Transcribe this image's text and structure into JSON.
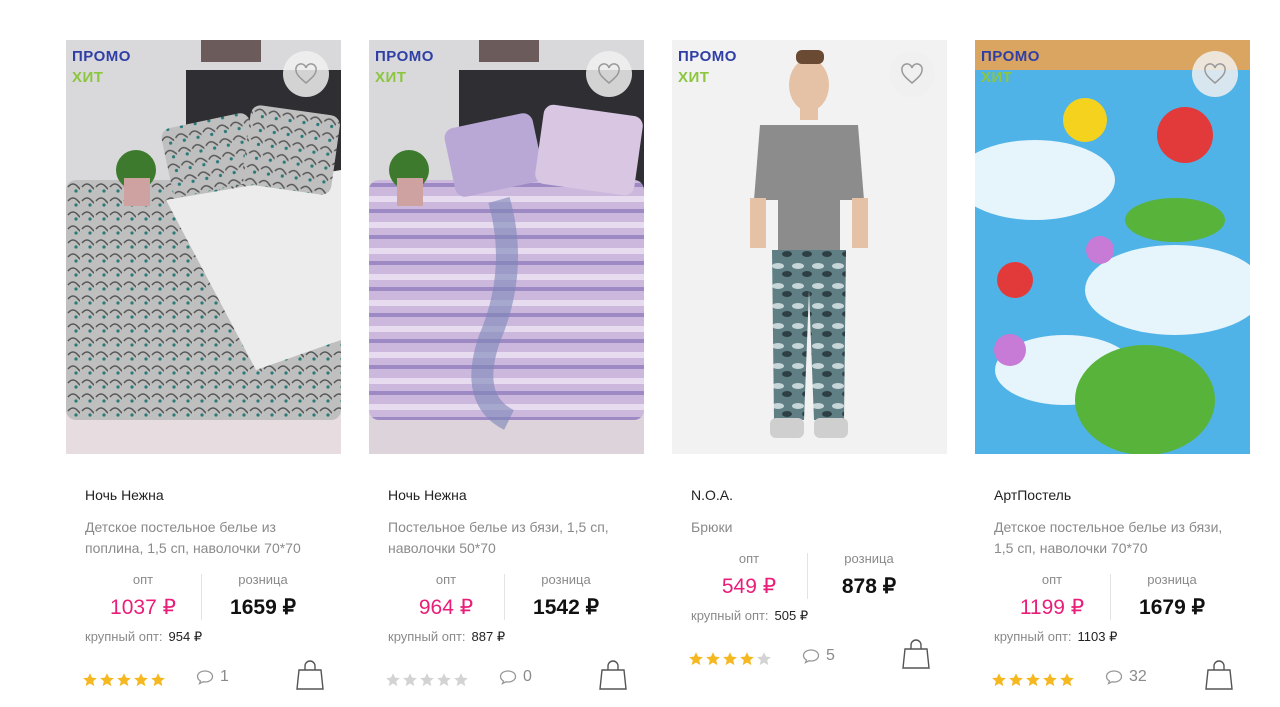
{
  "products": [
    {
      "badge_promo": "ПРОМО",
      "badge_hit": "ХИТ",
      "brand": "Ночь Нежна",
      "description": "Детское постельное белье из поплина, 1,5 сп, наволочки 70*70",
      "opt_label": "опт",
      "retail_label": "розница",
      "opt_price": "1037 ₽",
      "retail_price": "1659 ₽",
      "wholesale_label": "крупный опт:",
      "wholesale_price": "954 ₽",
      "rating": 5,
      "comments": "1"
    },
    {
      "badge_promo": "ПРОМО",
      "badge_hit": "ХИТ",
      "brand": "Ночь Нежна",
      "description": "Постельное белье из бязи, 1,5 сп, наволочки 50*70",
      "opt_label": "опт",
      "retail_label": "розница",
      "opt_price": "964 ₽",
      "retail_price": "1542 ₽",
      "wholesale_label": "крупный опт:",
      "wholesale_price": "887 ₽",
      "rating": 0,
      "comments": "0"
    },
    {
      "badge_promo": "ПРОМО",
      "badge_hit": "ХИТ",
      "brand": "N.O.A.",
      "description": "Брюки",
      "opt_label": "опт",
      "retail_label": "розница",
      "opt_price": "549 ₽",
      "retail_price": "878 ₽",
      "wholesale_label": "крупный опт:",
      "wholesale_price": "505 ₽",
      "rating": 4,
      "comments": "5"
    },
    {
      "badge_promo": "ПРОМО",
      "badge_hit": "ХИТ",
      "brand": "АртПостель",
      "description": "Детское постельное белье из бязи, 1,5 сп, наволочки 70*70",
      "opt_label": "опт",
      "retail_label": "розница",
      "opt_price": "1199 ₽",
      "retail_price": "1679 ₽",
      "wholesale_label": "крупный опт:",
      "wholesale_price": "1103 ₽",
      "rating": 5,
      "comments": "32"
    }
  ],
  "colors": {
    "promo": "#2f3fa6",
    "hit": "#8cc63f",
    "opt_price": "#e91e79",
    "star_on": "#f5b820",
    "star_off": "#d3d3d3"
  },
  "icons": {
    "favorite": "heart-outline-icon",
    "comment": "speech-bubble-icon",
    "cart": "shopping-bag-icon",
    "rating": "star-icon"
  }
}
